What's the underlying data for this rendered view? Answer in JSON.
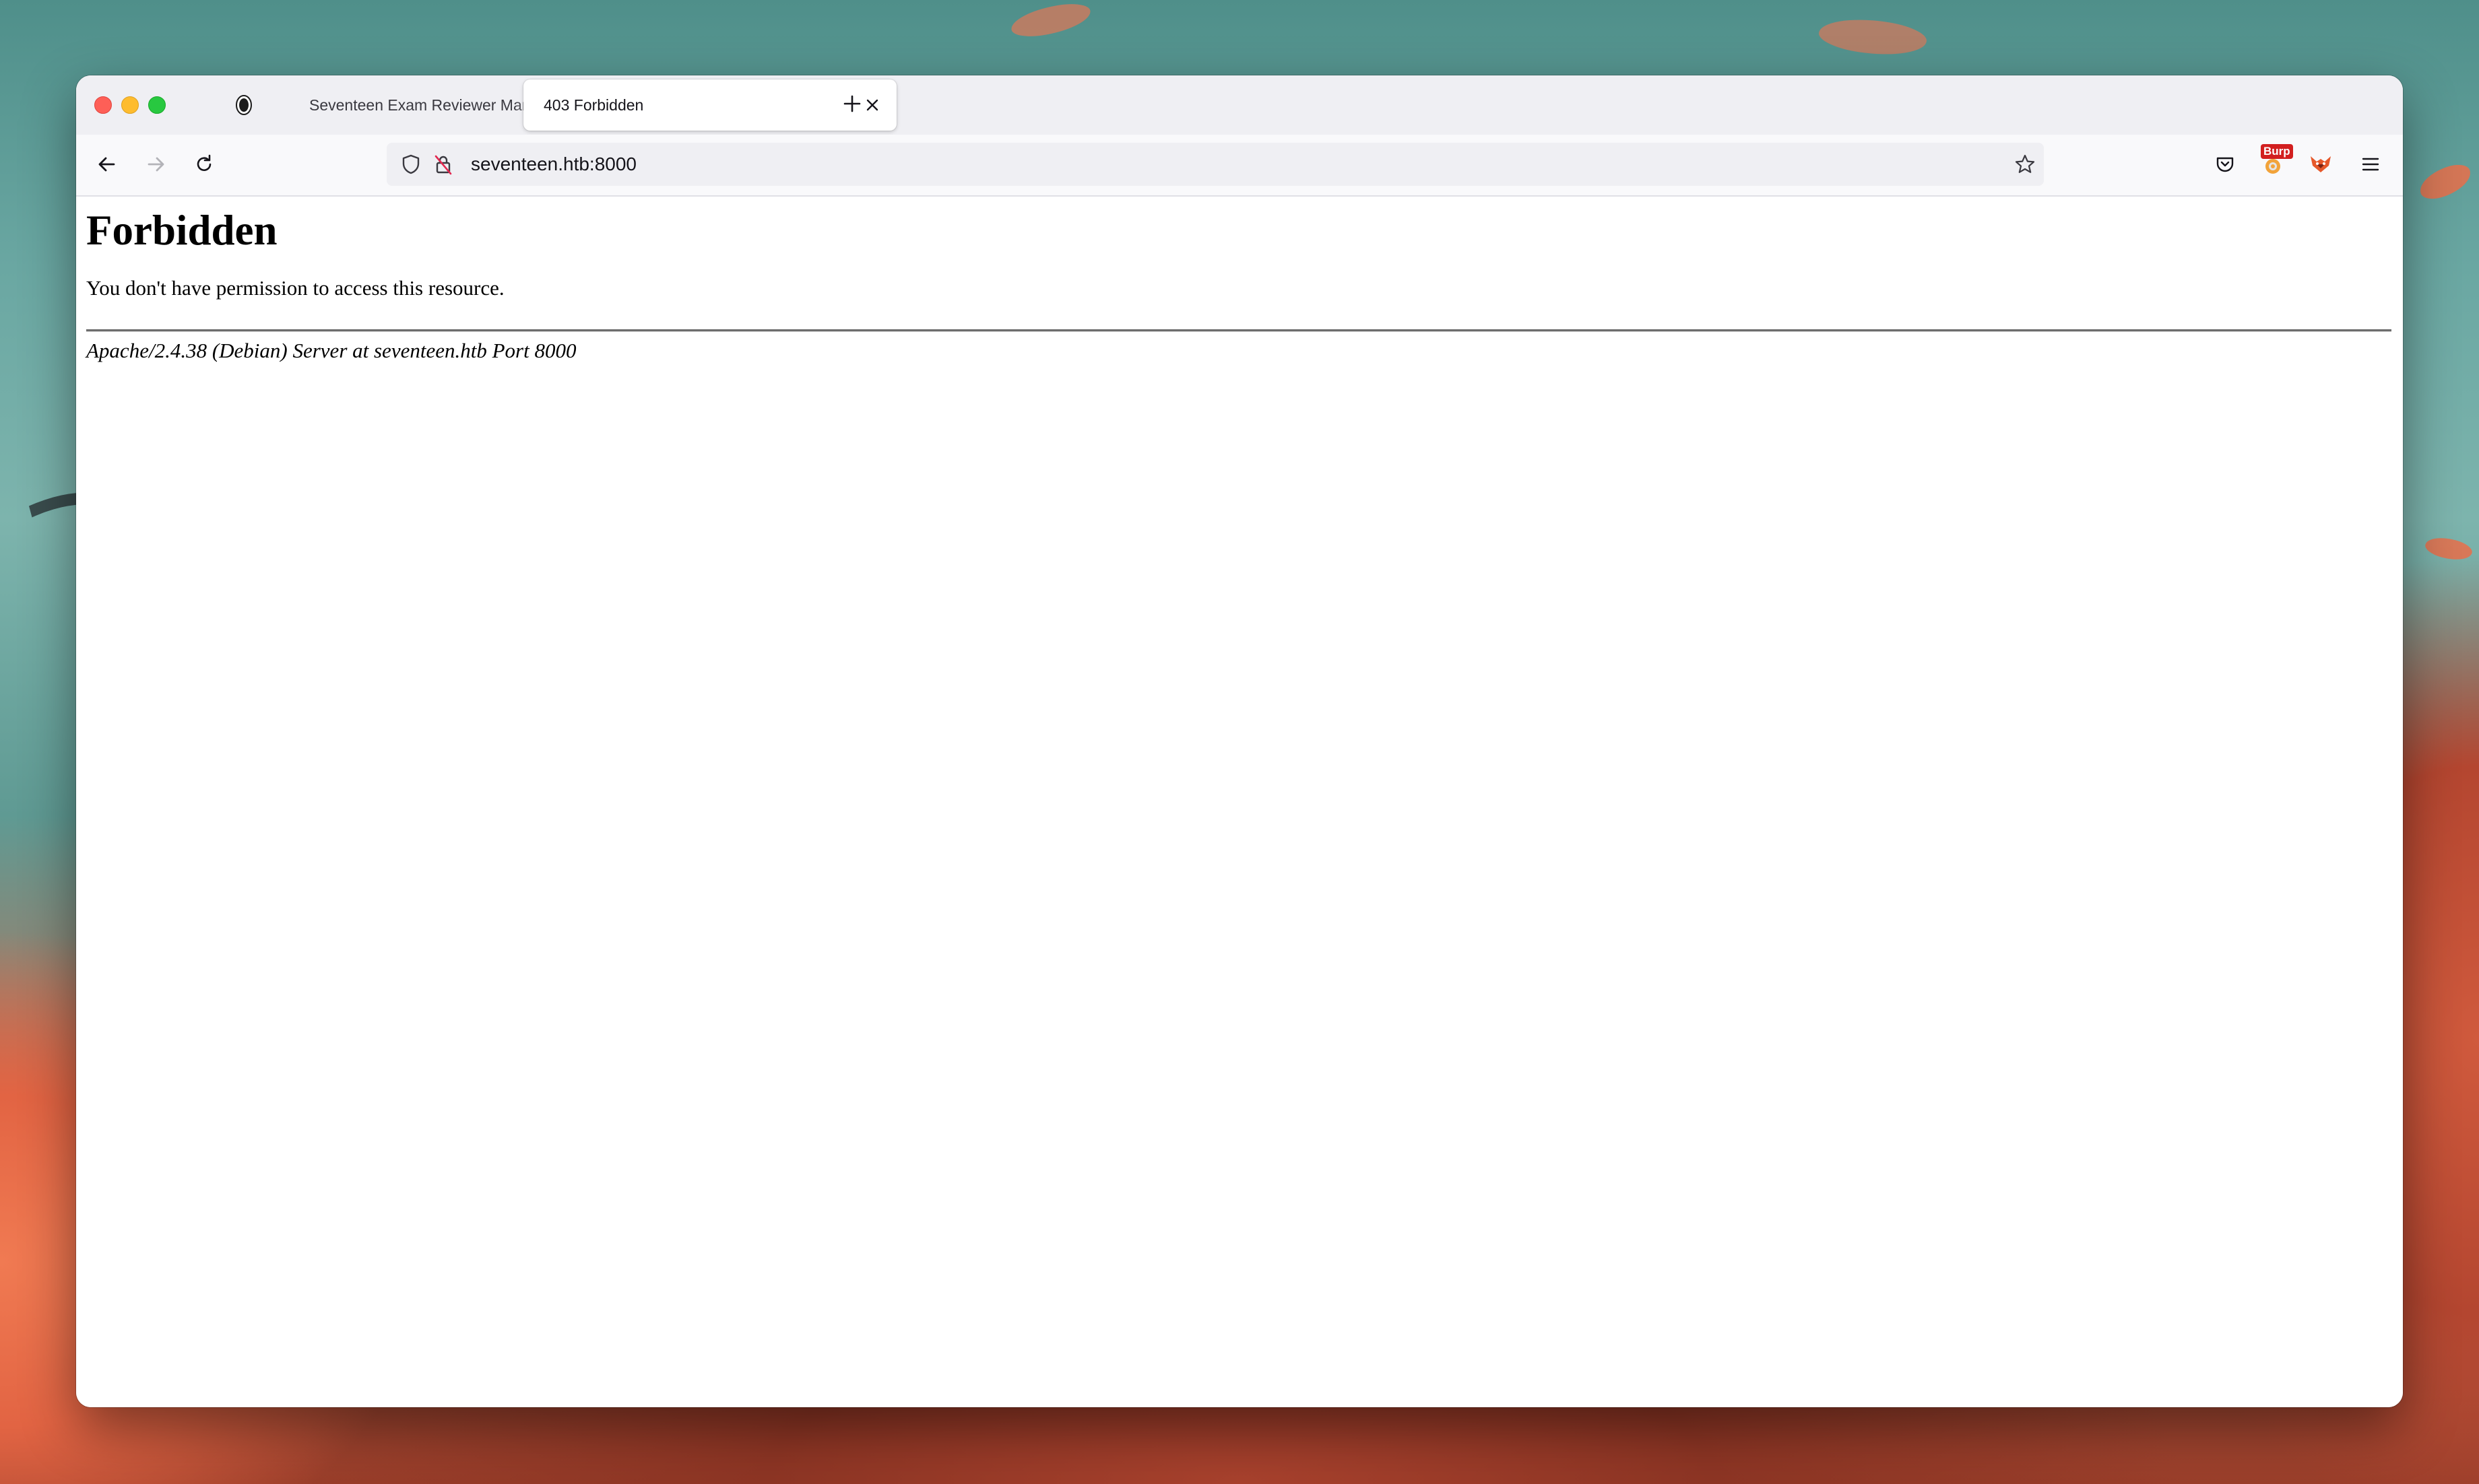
{
  "browser": {
    "tabs": [
      {
        "title": "Seventeen Exam Reviewer Management",
        "active": false,
        "favicon": "dark-circle-icon"
      },
      {
        "title": "403 Forbidden",
        "active": true
      }
    ],
    "address_bar": {
      "url": "seventeen.htb:8000",
      "icons": [
        "shield-icon",
        "insecure-lock-icon",
        "bookmark-star-icon"
      ]
    },
    "toolbar_icons": [
      "pocket-icon",
      "burp-extension-icon",
      "foxyproxy-icon",
      "menu-icon"
    ],
    "burp_badge": "Burp"
  },
  "page": {
    "heading": "Forbidden",
    "message": "You don't have permission to access this resource.",
    "server_signature": "Apache/2.4.38 (Debian) Server at seventeen.htb Port 8000"
  },
  "colors": {
    "traffic_red": "#fe5f57",
    "traffic_yellow": "#febc2e",
    "traffic_green": "#28c840",
    "tabbar_bg": "#efeff3",
    "navbar_bg": "#f9f9fb",
    "badge_red": "#d21f1f"
  }
}
